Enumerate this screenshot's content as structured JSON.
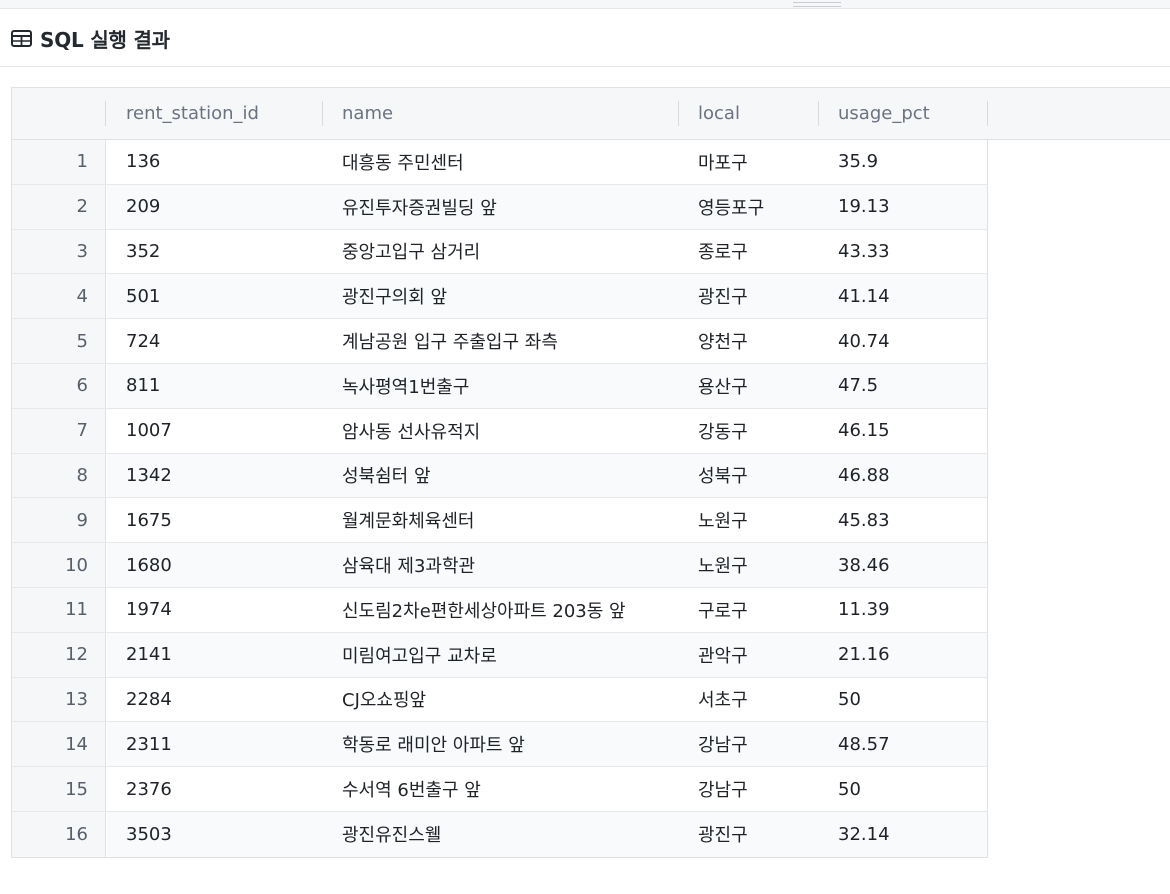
{
  "panel": {
    "title": "SQL 실행 결과",
    "icon": "table-icon"
  },
  "columns": [
    "rent_station_id",
    "name",
    "local",
    "usage_pct"
  ],
  "rows": [
    {
      "n": "1",
      "id": "136",
      "name": "대흥동 주민센터",
      "local": "마포구",
      "pct": "35.9"
    },
    {
      "n": "2",
      "id": "209",
      "name": "유진투자증권빌딩 앞",
      "local": "영등포구",
      "pct": "19.13"
    },
    {
      "n": "3",
      "id": "352",
      "name": "중앙고입구 삼거리",
      "local": "종로구",
      "pct": "43.33"
    },
    {
      "n": "4",
      "id": "501",
      "name": "광진구의회 앞",
      "local": "광진구",
      "pct": "41.14"
    },
    {
      "n": "5",
      "id": "724",
      "name": "계남공원 입구 주출입구 좌측",
      "local": "양천구",
      "pct": "40.74"
    },
    {
      "n": "6",
      "id": "811",
      "name": "녹사평역1번출구",
      "local": "용산구",
      "pct": "47.5"
    },
    {
      "n": "7",
      "id": "1007",
      "name": "암사동 선사유적지",
      "local": "강동구",
      "pct": "46.15"
    },
    {
      "n": "8",
      "id": "1342",
      "name": "성북쉼터 앞",
      "local": "성북구",
      "pct": "46.88"
    },
    {
      "n": "9",
      "id": "1675",
      "name": "월계문화체육센터",
      "local": "노원구",
      "pct": "45.83"
    },
    {
      "n": "10",
      "id": "1680",
      "name": "삼육대 제3과학관",
      "local": "노원구",
      "pct": "38.46"
    },
    {
      "n": "11",
      "id": "1974",
      "name": "신도림2차e편한세상아파트 203동 앞",
      "local": "구로구",
      "pct": "11.39"
    },
    {
      "n": "12",
      "id": "2141",
      "name": "미림여고입구 교차로",
      "local": "관악구",
      "pct": "21.16"
    },
    {
      "n": "13",
      "id": "2284",
      "name": "CJ오쇼핑앞",
      "local": "서초구",
      "pct": "50"
    },
    {
      "n": "14",
      "id": "2311",
      "name": "학동로 래미안 아파트 앞",
      "local": "강남구",
      "pct": "48.57"
    },
    {
      "n": "15",
      "id": "2376",
      "name": "수서역 6번출구 앞",
      "local": "강남구",
      "pct": "50"
    },
    {
      "n": "16",
      "id": "3503",
      "name": "광진유진스웰",
      "local": "광진구",
      "pct": "32.14"
    }
  ]
}
